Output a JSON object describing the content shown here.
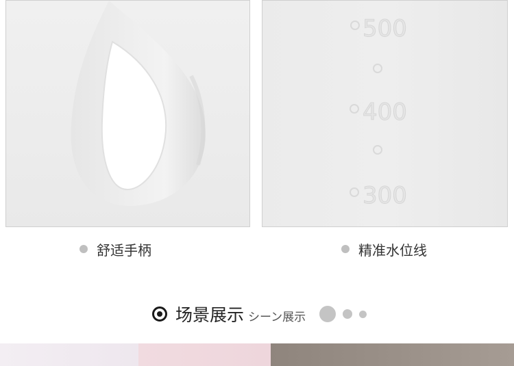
{
  "features": [
    {
      "label": "舒适手柄"
    },
    {
      "label": "精准水位线"
    }
  ],
  "scale": {
    "marks": [
      "500",
      "400",
      "300"
    ]
  },
  "section": {
    "title": "场景展示",
    "subtitle": "シーン展示",
    "dot_count": 3
  },
  "colors": {
    "caption_dot": "#bfbfbf",
    "title_icon": "#1a1a1a",
    "pager_dot": "#c4c4c4"
  }
}
